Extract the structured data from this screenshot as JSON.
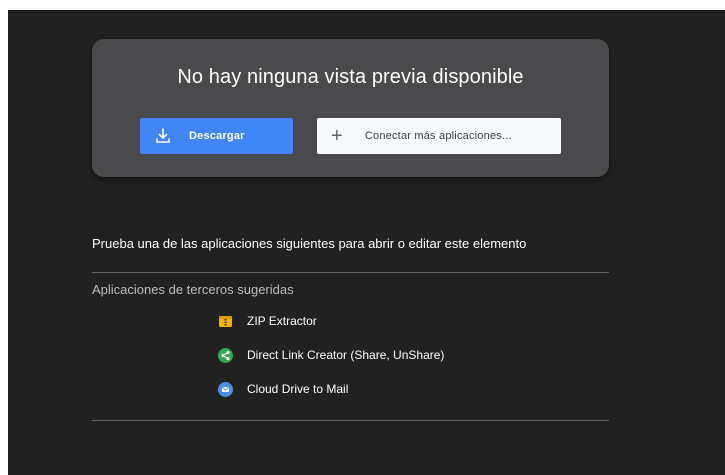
{
  "preview": {
    "title": "No hay ninguna vista previa disponible",
    "download_label": "Descargar",
    "connect_label": "Conectar más aplicaciones..."
  },
  "suggestions": {
    "prompt": "Prueba una de las aplicaciones siguientes para abrir o editar este elemento",
    "section_label": "Aplicaciones de terceros sugeridas",
    "apps": [
      {
        "label": "ZIP Extractor",
        "icon": "zip-extractor-icon",
        "color": "#f4b400"
      },
      {
        "label": "Direct Link Creator (Share, UnShare)",
        "icon": "share-icon",
        "color": "#34a853"
      },
      {
        "label": "Cloud Drive to Mail",
        "icon": "mail-icon",
        "color": "#4a90e2"
      }
    ]
  },
  "colors": {
    "background": "#212121",
    "card": "#4a4a4d",
    "accent": "#4285f4"
  }
}
